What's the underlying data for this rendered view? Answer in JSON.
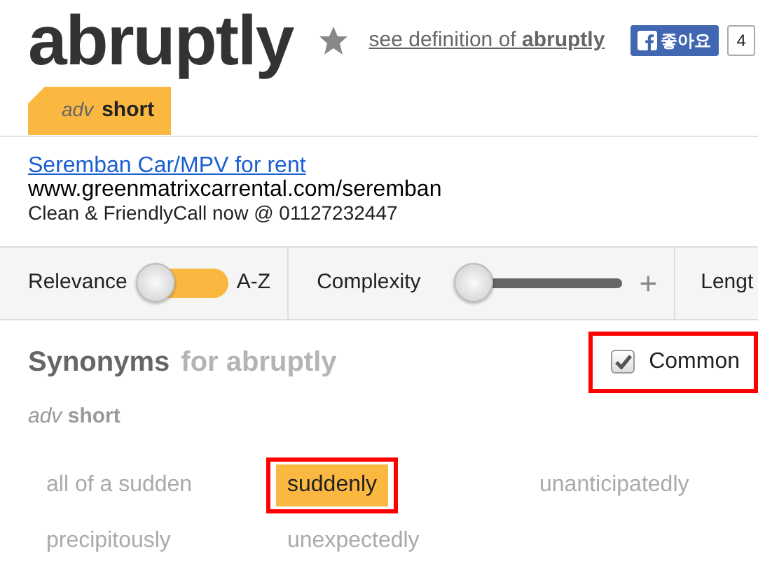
{
  "word": {
    "title": "abruptly",
    "favorite": false,
    "definition_link": {
      "prefix": "see definition of ",
      "word": "abruptly"
    },
    "like": {
      "label": "좋아요",
      "count": "4"
    }
  },
  "sense_tab": {
    "pos": "adv",
    "label": "short",
    "selected": true
  },
  "ad": {
    "title": "Seremban Car/MPV for rent",
    "url": "www.greenmatrixcarrental.com/seremban",
    "text": "Clean & FriendlyCall now @ 01127232447"
  },
  "filters": [
    {
      "kind": "toggle",
      "label": "Relevance",
      "label_right": "A-Z",
      "on": false
    },
    {
      "kind": "slider",
      "label": "Complexity",
      "level": 0,
      "plus": "+"
    },
    {
      "kind": "cut",
      "label": "Lengt"
    }
  ],
  "synonyms": {
    "title": "Synonyms",
    "subtitle": "for abruptly",
    "common": {
      "label": "Common",
      "checked": true,
      "highlighted": true
    },
    "sense": {
      "pos": "adv",
      "label": "short"
    },
    "words": [
      {
        "text": "all of a sudden",
        "selected": false,
        "highlighted": false
      },
      {
        "text": "suddenly",
        "selected": true,
        "highlighted": true
      },
      {
        "text": "unanticipatedly",
        "selected": false,
        "highlighted": false
      },
      {
        "text": "precipitously",
        "selected": false,
        "highlighted": false
      },
      {
        "text": "unexpectedly",
        "selected": false,
        "highlighted": false
      }
    ]
  }
}
